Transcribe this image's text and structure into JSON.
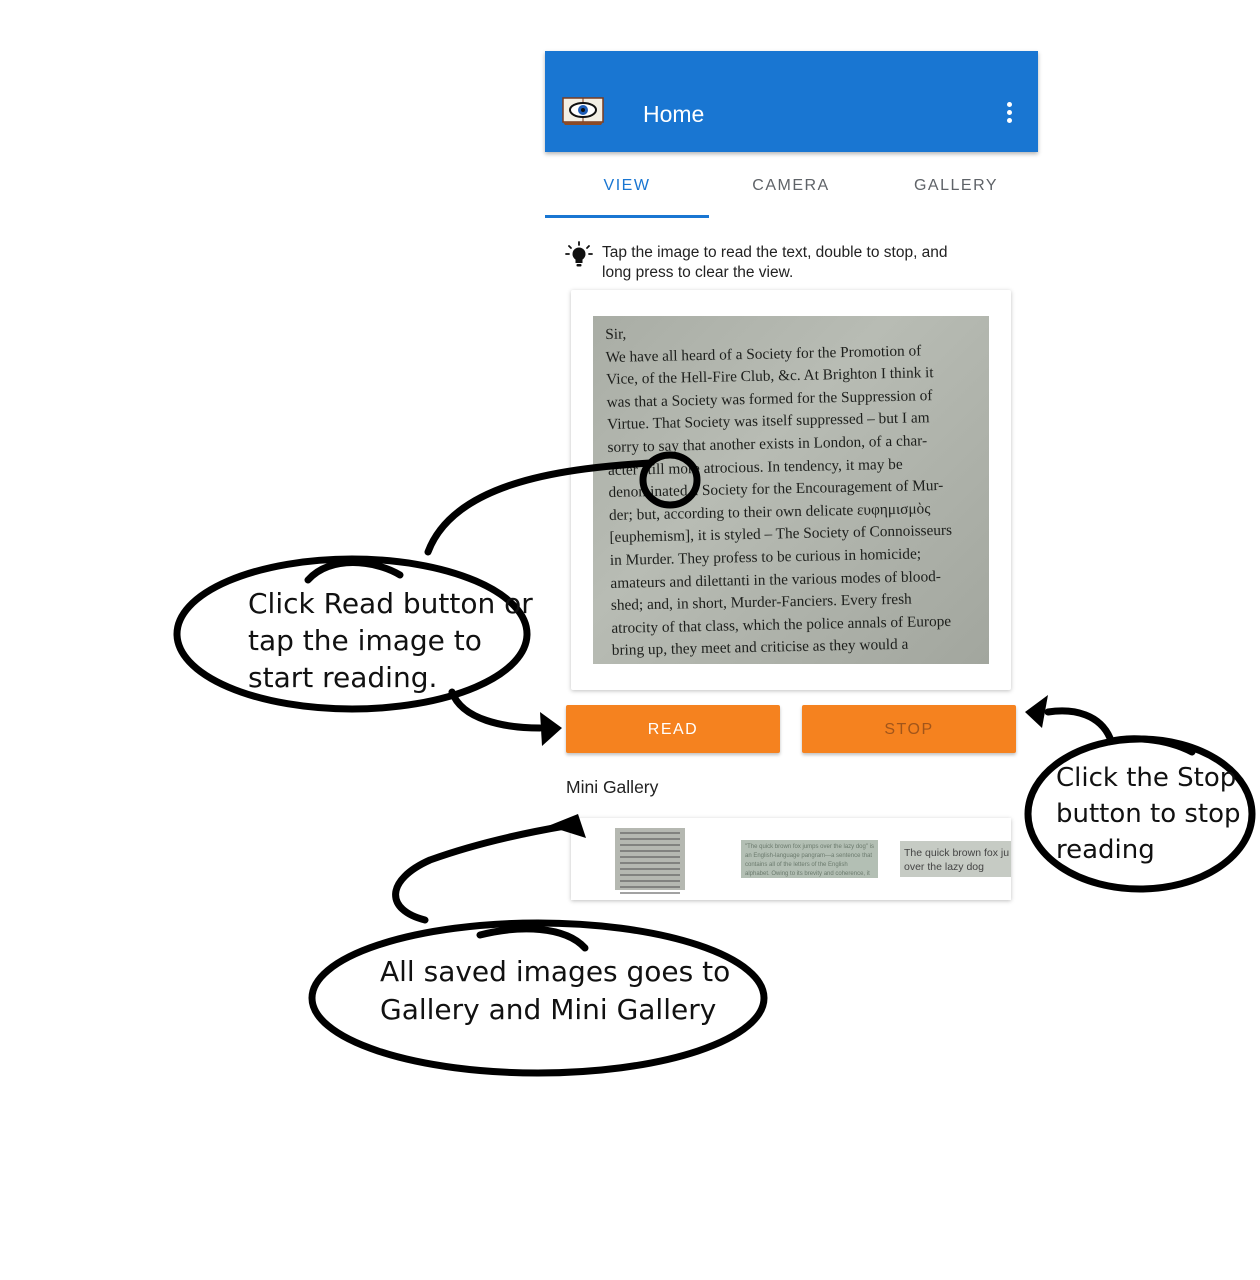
{
  "appbar": {
    "title": "Home"
  },
  "tabs": [
    {
      "label": "VIEW",
      "active": true
    },
    {
      "label": "CAMERA",
      "active": false
    },
    {
      "label": "GALLERY",
      "active": false
    }
  ],
  "hint": {
    "line1": "Tap the image to read the text, double to stop, and",
    "line2": "long press to clear the view."
  },
  "preview": {
    "lines": [
      "Sir,",
      "We have all heard of a Society for the Promotion of",
      "Vice, of the Hell-Fire Club, &c. At Brighton I think it",
      "was that a Society was formed for the Suppression of",
      "Virtue. That Society was itself suppressed – but I am",
      "sorry to say that another exists in London, of a char-",
      "acter still more atrocious. In tendency, it may be",
      "denominated a Society for the Encouragement of Mur-",
      "der; but, according to their own delicate ευφημισμὸς",
      "[euphemism], it is styled – The Society of Connoisseurs",
      "in Murder. They profess to be curious in homicide;",
      "amateurs and dilettanti in the various modes of blood-",
      "shed; and, in short, Murder-Fanciers. Every fresh",
      "atrocity of that class, which the police annals of Europe",
      "bring up, they meet and criticise as they would a"
    ]
  },
  "buttons": {
    "read": "READ",
    "stop": "STOP"
  },
  "mini_gallery": {
    "title": "Mini Gallery",
    "thumb2_text": "\"The quick brown fox jumps over the lazy dog\" is an English-language pangram—a sentence that contains all of the letters of the English alphabet. Owing to its brevity and coherence, it has become widely known.",
    "thumb3_line1": "The quick brown fox ju",
    "thumb3_line2": "over the lazy dog"
  },
  "annotations": {
    "read": [
      "Click Read button or",
      "tap the image to",
      "start reading."
    ],
    "stop": [
      "Click the Stop",
      "button to stop",
      "reading"
    ],
    "gallery": [
      "All saved images goes to",
      "Gallery and Mini Gallery"
    ]
  },
  "colors": {
    "appbar": "#1976d2",
    "accent": "#1976d2",
    "button": "#f5821f"
  },
  "icons": {
    "app": "book-eye-icon",
    "menu": "more-vertical-icon",
    "hint": "lightbulb-icon"
  }
}
